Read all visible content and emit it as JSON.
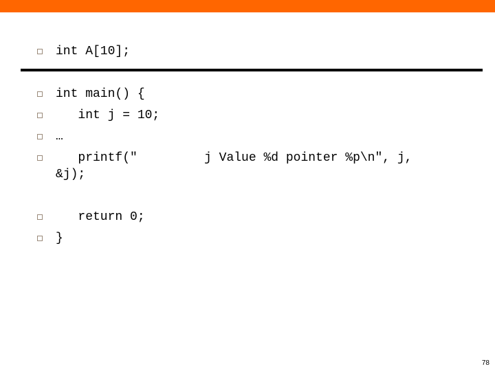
{
  "colors": {
    "top_bar": "#ff6600",
    "rule": "#000000",
    "bullet_border": "#9a8a7a"
  },
  "header_line": "int A[10];",
  "code_lines": [
    "int main() {",
    "   int j = 10;",
    "…",
    "   printf(\"         j Value %d pointer %p\\n\", j,",
    "   return 0;",
    "}"
  ],
  "printf_continuation": "&j);",
  "bullet_icon": "square-bullet-icon",
  "page_number": "78"
}
